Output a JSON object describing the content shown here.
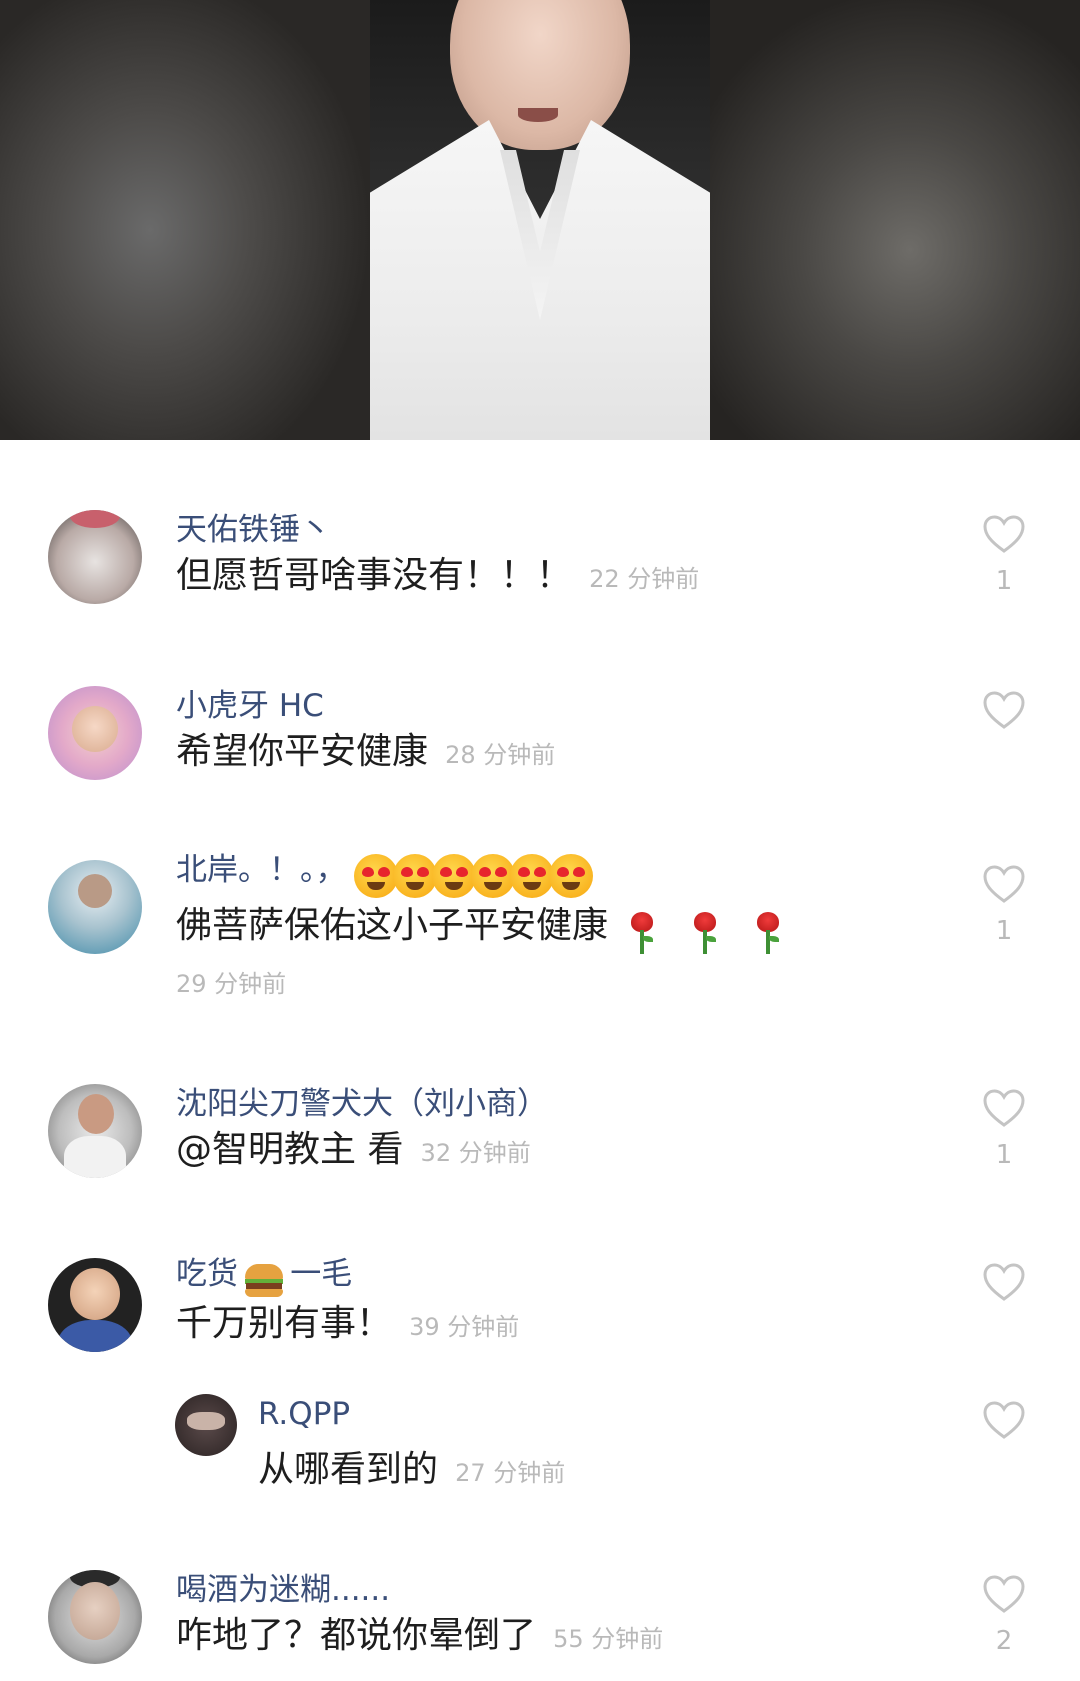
{
  "comments": [
    {
      "username": "天佑铁锤丶",
      "text": "但愿哲哥啥事没有！！！",
      "time": "22 分钟前",
      "likes": "1"
    },
    {
      "username": "小虎牙 HC",
      "text": "希望你平安健康",
      "time": "28 分钟前",
      "likes": ""
    },
    {
      "username": "北岸。！。，",
      "text": "佛菩萨保佑这小子平安健康",
      "time": "29 分钟前",
      "likes": "1",
      "username_emoji": [
        "heart-eyes",
        "heart-eyes",
        "heart-eyes",
        "heart-eyes",
        "heart-eyes",
        "heart-eyes"
      ],
      "text_emoji": [
        "rose",
        "rose",
        "rose"
      ]
    },
    {
      "username": "沈阳尖刀警犬大（刘小商）",
      "text": "@智明教主 看",
      "time": "32 分钟前",
      "likes": "1"
    },
    {
      "username_part1": "吃货",
      "username_part2": "一毛",
      "username_emoji": [
        "hamburger"
      ],
      "text": "千万别有事！",
      "time": "39 分钟前",
      "likes": ""
    },
    {
      "username": "R.QPP",
      "text": "从哪看到的",
      "time": "27 分钟前",
      "likes": "",
      "is_reply": true
    },
    {
      "username": "喝酒为迷糊......",
      "text": "咋地了？都说你晕倒了",
      "time": "55 分钟前",
      "likes": "2"
    }
  ],
  "colors": {
    "username": "#3a4e78",
    "text": "#1e1e1e",
    "time": "#b9b9b9",
    "heart_outline": "#c4c4c4"
  },
  "icons": {
    "like": "heart-outline-icon"
  }
}
